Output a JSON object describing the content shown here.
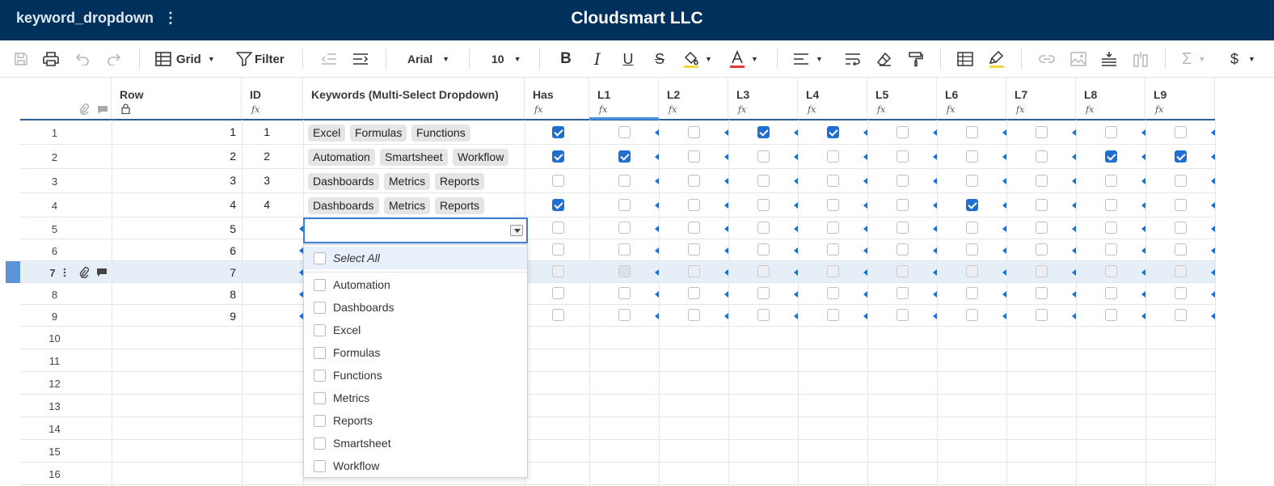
{
  "app": {
    "sheet_name": "keyword_dropdown",
    "menu_glyph": "⋮",
    "workspace": "Cloudsmart LLC"
  },
  "toolbar": {
    "view_label": "Grid",
    "filter_label": "Filter",
    "font_name": "Arial",
    "font_size": "10",
    "bold_glyph": "B",
    "italic_glyph": "I",
    "underline_glyph": "U",
    "strike_glyph": "S",
    "sum_glyph": "Σ",
    "currency_glyph": "$",
    "text_color": "#e53935",
    "highlight_color": "#f5d742"
  },
  "columns": {
    "row": "Row",
    "id": "ID",
    "keywords": "Keywords (Multi-Select Dropdown)",
    "has": "Has",
    "levels": [
      "L1",
      "L2",
      "L3",
      "L4",
      "L5",
      "L6",
      "L7",
      "L8",
      "L9"
    ],
    "fx_glyph": "fx",
    "lock_glyph": "🔒"
  },
  "rows": [
    {
      "num": "1",
      "row": "1",
      "id": "1",
      "keywords": [
        "Excel",
        "Formulas",
        "Functions"
      ],
      "has": true,
      "levels": [
        false,
        false,
        true,
        true,
        false,
        false,
        false,
        false,
        false
      ]
    },
    {
      "num": "2",
      "row": "2",
      "id": "2",
      "keywords": [
        "Automation",
        "Smartsheet",
        "Workflow"
      ],
      "has": true,
      "levels": [
        true,
        false,
        false,
        false,
        false,
        false,
        false,
        true,
        true
      ]
    },
    {
      "num": "3",
      "row": "3",
      "id": "3",
      "keywords": [
        "Dashboards",
        "Metrics",
        "Reports"
      ],
      "has": false,
      "levels": [
        false,
        false,
        false,
        false,
        false,
        false,
        false,
        false,
        false
      ]
    },
    {
      "num": "4",
      "row": "4",
      "id": "4",
      "keywords": [
        "Dashboards",
        "Metrics",
        "Reports"
      ],
      "has": true,
      "levels": [
        false,
        false,
        false,
        false,
        false,
        true,
        false,
        false,
        false
      ]
    },
    {
      "num": "5",
      "row": "5",
      "id": "",
      "keywords": [],
      "has": false,
      "levels": [
        false,
        false,
        false,
        false,
        false,
        false,
        false,
        false,
        false
      ]
    },
    {
      "num": "6",
      "row": "6",
      "id": "",
      "keywords": [],
      "has": false,
      "levels": [
        false,
        false,
        false,
        false,
        false,
        false,
        false,
        false,
        false
      ]
    },
    {
      "num": "7",
      "row": "7",
      "id": "",
      "keywords": [],
      "has": false,
      "levels": [
        false,
        false,
        false,
        false,
        false,
        false,
        false,
        false,
        false
      ]
    },
    {
      "num": "8",
      "row": "8",
      "id": "",
      "keywords": [],
      "has": false,
      "levels": [
        false,
        false,
        false,
        false,
        false,
        false,
        false,
        false,
        false
      ]
    },
    {
      "num": "9",
      "row": "9",
      "id": "",
      "keywords": [],
      "has": false,
      "levels": [
        false,
        false,
        false,
        false,
        false,
        false,
        false,
        false,
        false
      ]
    },
    {
      "num": "10"
    },
    {
      "num": "11"
    },
    {
      "num": "12"
    },
    {
      "num": "13"
    },
    {
      "num": "14"
    },
    {
      "num": "15"
    },
    {
      "num": "16"
    }
  ],
  "selected_row": "7",
  "dropdown": {
    "value": "",
    "select_all": "Select All",
    "options": [
      "Automation",
      "Dashboards",
      "Excel",
      "Formulas",
      "Functions",
      "Metrics",
      "Reports",
      "Smartsheet",
      "Workflow"
    ]
  },
  "colors": {
    "topbar": "#00305c",
    "accent": "#1f6fd1"
  }
}
